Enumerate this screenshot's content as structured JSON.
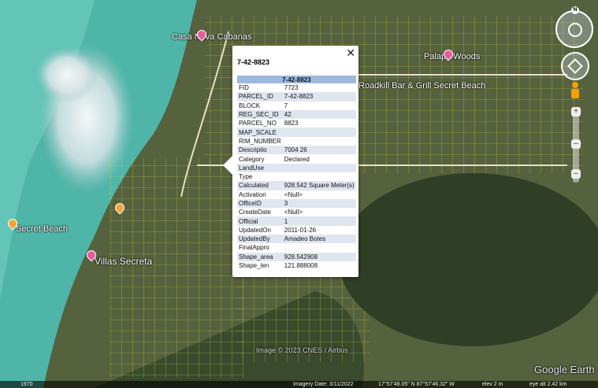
{
  "map_labels": {
    "casa_nova": "Casa Nova Cabanas",
    "palapa_woods": "Palapa Woods",
    "roadkill": "Roadkill Bar & Grill Secret Beach",
    "secret_beach": "Secret Beach",
    "villas_secreta": "Villas Secreta"
  },
  "popup": {
    "title": "7-42-8823",
    "close": "✕",
    "header": "7-42-8823",
    "rows": [
      [
        "FID",
        "7723"
      ],
      [
        "PARCEL_ID",
        "7-42-8823"
      ],
      [
        "BLOCK",
        "7"
      ],
      [
        "REG_SEC_ID",
        "42"
      ],
      [
        "PARCEL_NO",
        "8823"
      ],
      [
        "MAP_SCALE",
        ""
      ],
      [
        "RIM_NUMBER",
        ""
      ],
      [
        "Descriptio",
        "7004 26"
      ],
      [
        "Category",
        "Declared"
      ],
      [
        "LandUse",
        ""
      ],
      [
        "Type",
        ""
      ],
      [
        "Calculated",
        "928.542 Square Meter(s)"
      ],
      [
        "Activation",
        "<Null>"
      ],
      [
        "OfficeID",
        "3"
      ],
      [
        "CreateDate",
        "<Null>"
      ],
      [
        "Official",
        "1"
      ],
      [
        "UpdatedOn",
        "2011-01-26"
      ],
      [
        "UpdatedBy",
        "Amadeo Botes"
      ],
      [
        "FinalAppro",
        ""
      ],
      [
        "Shape_area",
        "928.542908"
      ],
      [
        "Shape_len",
        "121.888008"
      ]
    ]
  },
  "attribution": "Image © 2023 CNES / Airbus",
  "google_earth": "Google Earth",
  "status": {
    "year": "1970",
    "imagery_date": "Imagery Date: 3/11/2022",
    "coords": "17°57'48.05\" N   87°57'46.32\" W",
    "elev": "elev    2 m",
    "eye_alt": "eye alt  2.42 km"
  },
  "nav_letter": "N"
}
